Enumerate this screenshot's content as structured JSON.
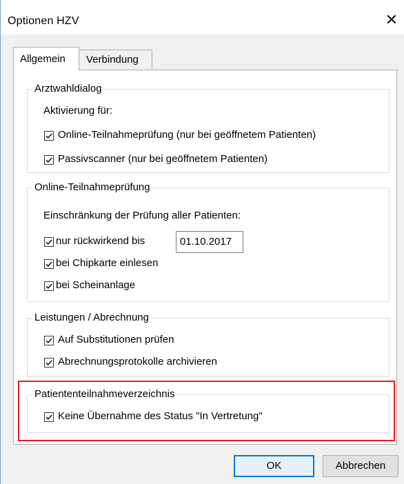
{
  "window": {
    "title": "Optionen HZV",
    "close_symbol": "✕"
  },
  "tabs": [
    {
      "label": "Allgemein",
      "active": true
    },
    {
      "label": "Verbindung",
      "active": false
    }
  ],
  "groups": {
    "arztwahl": {
      "legend": "Arztwahldialog",
      "subtitle": "Aktivierung für:",
      "options": [
        {
          "label": "Online-Teilnahmeprüfung (nur bei geöffnetem Patienten)",
          "checked": true
        },
        {
          "label": "Passivscanner (nur bei geöffnetem Patienten)",
          "checked": true
        }
      ]
    },
    "online": {
      "legend": "Online-Teilnahmeprüfung",
      "subtitle": "Einschränkung der Prüfung aller Patienten:",
      "options": [
        {
          "label": "nur rückwirkend bis",
          "checked": true
        },
        {
          "label": "bei Chipkarte einlesen",
          "checked": true
        },
        {
          "label": "bei Scheinanlage",
          "checked": true
        }
      ],
      "date_value": "01.10.2017"
    },
    "leistungen": {
      "legend": "Leistungen / Abrechnung",
      "options": [
        {
          "label": "Auf Substitutionen prüfen",
          "checked": true
        },
        {
          "label": "Abrechnungsprotokolle archivieren",
          "checked": true
        }
      ]
    },
    "patienten": {
      "legend": "Patiententeilnahmeverzeichnis",
      "options": [
        {
          "label": "Keine Übernahme des Status \"In Vertretung\"",
          "checked": true
        }
      ]
    }
  },
  "buttons": {
    "ok": "OK",
    "cancel": "Abbrechen"
  },
  "colors": {
    "highlight": "#e31b23",
    "accent": "#0078d7",
    "dialog_bg": "#f0f0f0"
  }
}
